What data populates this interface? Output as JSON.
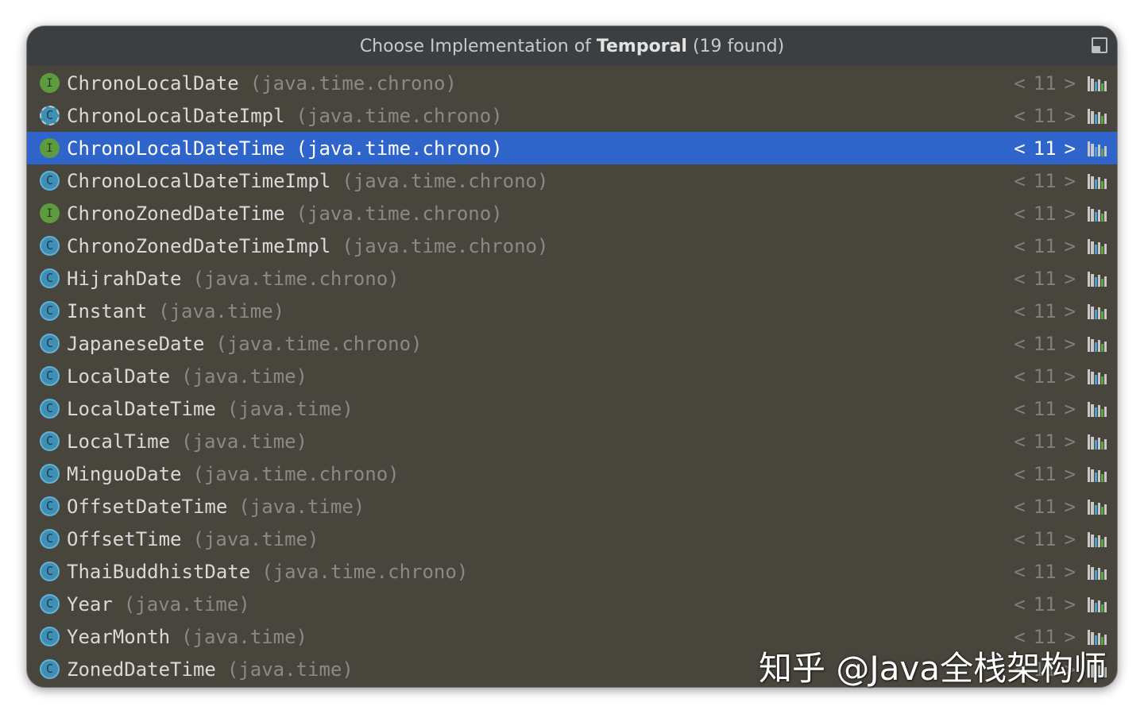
{
  "popup": {
    "title_prefix": "Choose Implementation of",
    "title_target": "Temporal",
    "title_suffix": "(19 found)"
  },
  "colors": {
    "background": "#48453c",
    "titlebar": "#3c3f41",
    "selection": "#2f65ca",
    "interface_icon": "#5e9b3e",
    "class_icon": "#3f8fb5"
  },
  "items": [
    {
      "name": "ChronoLocalDate",
      "package": "(java.time.chrono)",
      "kind": "interface",
      "icon": "I",
      "prev": "<",
      "version": "11",
      "next": ">",
      "selected": false
    },
    {
      "name": "ChronoLocalDateImpl",
      "package": "(java.time.chrono)",
      "kind": "abstract",
      "icon": "C",
      "prev": "<",
      "version": "11",
      "next": ">",
      "selected": false
    },
    {
      "name": "ChronoLocalDateTime",
      "package": "(java.time.chrono)",
      "kind": "interface",
      "icon": "I",
      "prev": "<",
      "version": "11",
      "next": ">",
      "selected": true
    },
    {
      "name": "ChronoLocalDateTimeImpl",
      "package": "(java.time.chrono)",
      "kind": "class",
      "icon": "C",
      "prev": "<",
      "version": "11",
      "next": ">",
      "selected": false
    },
    {
      "name": "ChronoZonedDateTime",
      "package": "(java.time.chrono)",
      "kind": "interface",
      "icon": "I",
      "prev": "<",
      "version": "11",
      "next": ">",
      "selected": false
    },
    {
      "name": "ChronoZonedDateTimeImpl",
      "package": "(java.time.chrono)",
      "kind": "class",
      "icon": "C",
      "prev": "<",
      "version": "11",
      "next": ">",
      "selected": false
    },
    {
      "name": "HijrahDate",
      "package": "(java.time.chrono)",
      "kind": "class",
      "icon": "C",
      "prev": "<",
      "version": "11",
      "next": ">",
      "selected": false
    },
    {
      "name": "Instant",
      "package": "(java.time)",
      "kind": "class",
      "icon": "C",
      "prev": "<",
      "version": "11",
      "next": ">",
      "selected": false
    },
    {
      "name": "JapaneseDate",
      "package": "(java.time.chrono)",
      "kind": "class",
      "icon": "C",
      "prev": "<",
      "version": "11",
      "next": ">",
      "selected": false
    },
    {
      "name": "LocalDate",
      "package": "(java.time)",
      "kind": "class",
      "icon": "C",
      "prev": "<",
      "version": "11",
      "next": ">",
      "selected": false
    },
    {
      "name": "LocalDateTime",
      "package": "(java.time)",
      "kind": "class",
      "icon": "C",
      "prev": "<",
      "version": "11",
      "next": ">",
      "selected": false
    },
    {
      "name": "LocalTime",
      "package": "(java.time)",
      "kind": "class",
      "icon": "C",
      "prev": "<",
      "version": "11",
      "next": ">",
      "selected": false
    },
    {
      "name": "MinguoDate",
      "package": "(java.time.chrono)",
      "kind": "class",
      "icon": "C",
      "prev": "<",
      "version": "11",
      "next": ">",
      "selected": false
    },
    {
      "name": "OffsetDateTime",
      "package": "(java.time)",
      "kind": "class",
      "icon": "C",
      "prev": "<",
      "version": "11",
      "next": ">",
      "selected": false
    },
    {
      "name": "OffsetTime",
      "package": "(java.time)",
      "kind": "class",
      "icon": "C",
      "prev": "<",
      "version": "11",
      "next": ">",
      "selected": false
    },
    {
      "name": "ThaiBuddhistDate",
      "package": "(java.time.chrono)",
      "kind": "class",
      "icon": "C",
      "prev": "<",
      "version": "11",
      "next": ">",
      "selected": false
    },
    {
      "name": "Year",
      "package": "(java.time)",
      "kind": "class",
      "icon": "C",
      "prev": "<",
      "version": "11",
      "next": ">",
      "selected": false
    },
    {
      "name": "YearMonth",
      "package": "(java.time)",
      "kind": "class",
      "icon": "C",
      "prev": "<",
      "version": "11",
      "next": ">",
      "selected": false
    },
    {
      "name": "ZonedDateTime",
      "package": "(java.time)",
      "kind": "class",
      "icon": "C",
      "prev": "<",
      "version": "11",
      "next": ">",
      "selected": false
    }
  ],
  "row_icon": "library-icon",
  "watermark": "知乎 @Java全栈架构师"
}
